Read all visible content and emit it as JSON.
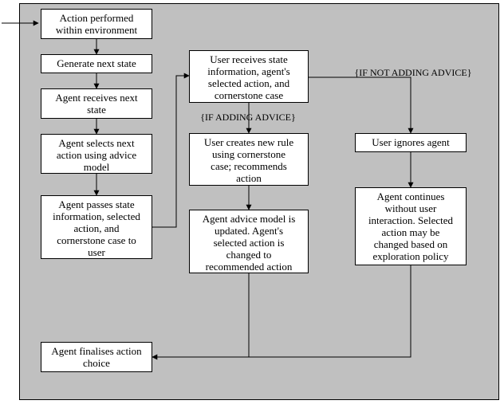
{
  "boxes": {
    "action_performed": "Action performed\nwithin environment",
    "generate_next": "Generate next state",
    "agent_receives": "Agent receives next\nstate",
    "agent_selects": "Agent selects next\naction using advice\nmodel",
    "agent_passes": "Agent passes state\ninformation, selected\naction, and\ncornerstone case to\nuser",
    "user_receives": "User receives state\ninformation, agent's\nselected action, and\ncornerstone case",
    "user_creates": "User creates new rule\nusing cornerstone\ncase; recommends\naction",
    "advice_updated": "Agent advice model is\nupdated. Agent's\nselected action is\nchanged to\nrecommended action",
    "user_ignores": "User ignores agent",
    "agent_continues": "Agent continues\nwithout user\ninteraction. Selected\naction may be\nchanged based on\nexploration policy",
    "agent_finalises": "Agent finalises action\nchoice"
  },
  "labels": {
    "if_adding": "{IF ADDING ADVICE}",
    "if_not_adding": "{IF NOT ADDING ADVICE}"
  }
}
